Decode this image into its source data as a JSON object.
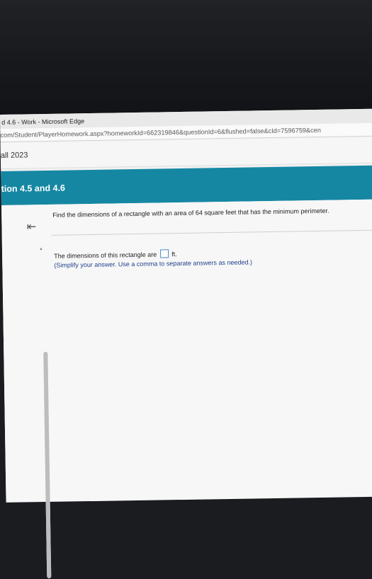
{
  "browser": {
    "window_title": "d 4.6 - Work - Microsoft Edge",
    "address": "com/Student/PlayerHomework.aspx?homeworkId=662319846&questionId=6&flushed=false&cId=7596759&cen"
  },
  "course": {
    "term": "all 2023",
    "section_title": "tion 4.5 and 4.6"
  },
  "question": {
    "back_icon": "back-to-start-arrow",
    "prompt": "Find the dimensions of a rectangle with an area of 64 square feet that has the minimum perimeter.",
    "answer_prefix": "The dimensions of this rectangle are",
    "answer_value": "",
    "answer_unit": "ft.",
    "hint": "(Simplify your answer. Use a comma to separate answers as needed.)"
  },
  "colors": {
    "header_teal": "#1587a3",
    "answer_box_border": "#4a89c8",
    "hint_blue": "#1f3f8a"
  }
}
